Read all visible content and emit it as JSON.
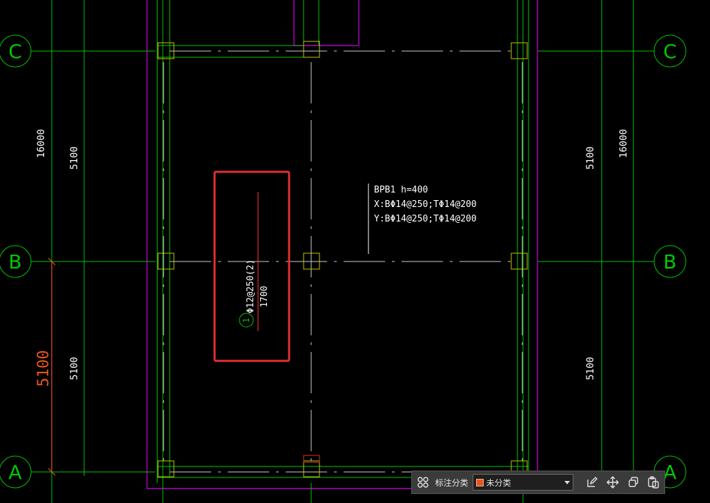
{
  "drawing": {
    "grid_axes": {
      "top": "C",
      "middle": "B",
      "bottom": "A"
    },
    "dimensions": {
      "left_total": "16000",
      "left_upper": "5100",
      "left_lower": "5100",
      "left_lower_highlight": "5100",
      "right_total": "16000",
      "right_upper": "5100",
      "right_lower": "5100"
    },
    "slab_annotation": {
      "line1": "BPB1 h=400",
      "line2": "X:BΦ14@250;TΦ14@200",
      "line3": "Y:BΦ14@250;TΦ14@200"
    },
    "rebar_annotation": {
      "spec": "Φ12@250(2)",
      "length": "1700",
      "mark": "1"
    }
  },
  "toolbar": {
    "category_label": "标注分类",
    "category_value": "未分类",
    "category_color": "#e8541e"
  },
  "colors": {
    "axis": "#00c800",
    "wall": "#b400c8",
    "column": "#c8c800",
    "dim_text": "#ffffff",
    "highlight_box": "#e23030",
    "orange_dim": "#e8541e"
  }
}
